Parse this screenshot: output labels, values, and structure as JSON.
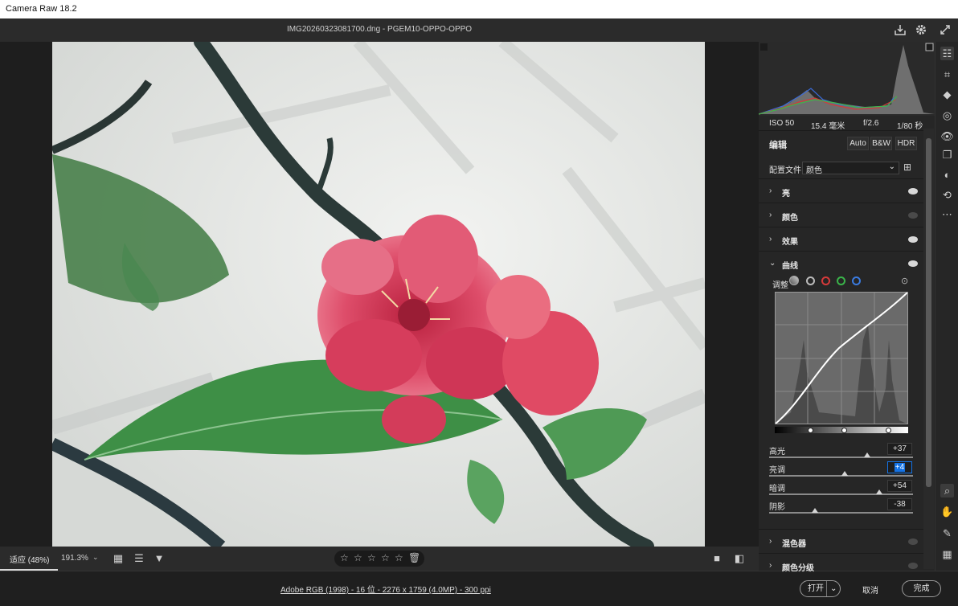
{
  "window": {
    "title": "Camera Raw 18.2"
  },
  "topbar": {
    "filename": "IMG20260323081700.dng - PGEM10-OPPO-OPPO"
  },
  "bottombar": {
    "zoom_fit": "适应 (48%)",
    "zoom_value": "191.3%",
    "stars": [
      "☆",
      "☆",
      "☆",
      "☆",
      "☆"
    ]
  },
  "footer": {
    "info": "Adobe RGB (1998) - 16 位 - 2276 x 1759 (4.0MP) - 300 ppi",
    "open": "打开",
    "cancel": "取消",
    "done": "完成"
  },
  "panel": {
    "exif": {
      "iso": "ISO 50",
      "focal": "15.4 毫米",
      "aperture": "f/2.6",
      "shutter": "1/80 秒"
    },
    "edit_label": "编辑",
    "auto": "Auto",
    "bw": "B&W",
    "hdr": "HDR",
    "profile_label": "配置文件",
    "profile_value": "颜色",
    "sections": {
      "light": "亮",
      "color": "颜色",
      "effects": "效果",
      "curve": "曲线",
      "mixer": "混色器",
      "grading": "颜色分级"
    },
    "curve_adjust_label": "调整",
    "sliders": [
      {
        "label": "高光",
        "value": "+37",
        "pos": 0.68
      },
      {
        "label": "亮调",
        "value": "+4",
        "pos": 0.52
      },
      {
        "label": "暗调",
        "value": "+54",
        "pos": 0.77
      },
      {
        "label": "阴影",
        "value": "-38",
        "pos": 0.31
      }
    ]
  },
  "colors": {
    "accent": "#1473e6",
    "panel": "#262626",
    "background": "#1e1e1e"
  }
}
